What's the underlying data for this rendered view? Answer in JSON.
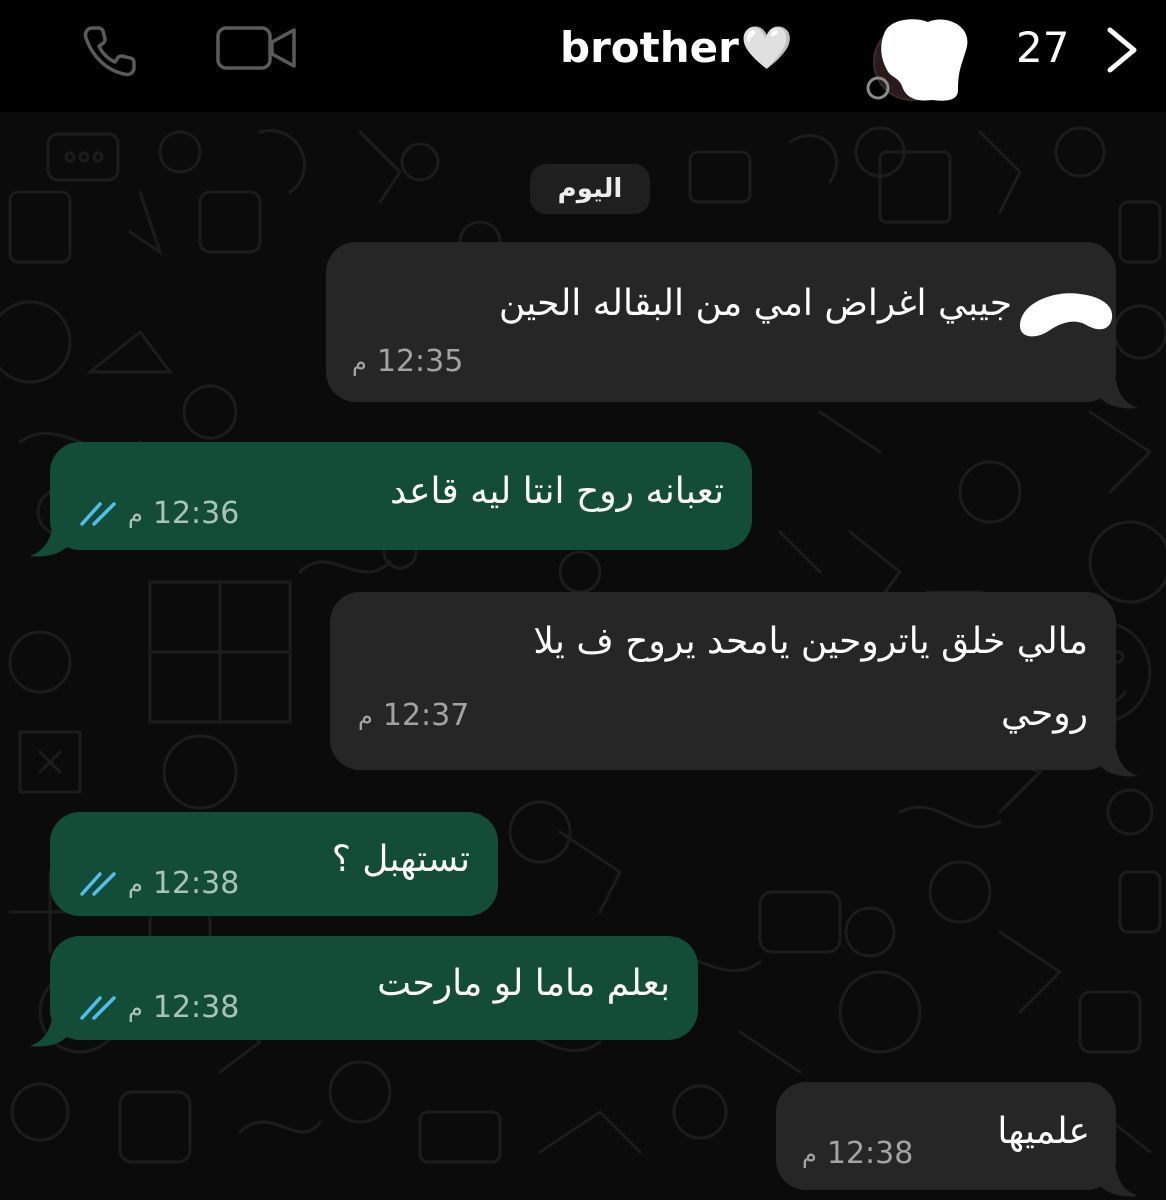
{
  "header": {
    "contact_name": "brother",
    "name_emoji": "🤍",
    "back_count": "27",
    "icons": {
      "call": "phone-icon",
      "video": "video-call-icon",
      "back": "chevron-right-icon",
      "avatar": "avatar-icon"
    }
  },
  "chat": {
    "day_label": "اليوم",
    "messages": [
      {
        "direction": "incoming",
        "text": "جيبي اغراض امي من البقاله الحين",
        "time": "12:35",
        "ampm": "م",
        "read": false
      },
      {
        "direction": "outgoing",
        "text": "تعبانه روح انتا ليه قاعد",
        "time": "12:36",
        "ampm": "م",
        "read": true
      },
      {
        "direction": "incoming",
        "text_line1": "مالي خلق ياتروحين يامحد يروح ف يلا",
        "text_line2": "روحي",
        "time": "12:37",
        "ampm": "م",
        "read": false
      },
      {
        "direction": "outgoing",
        "text": "تستهبل ؟",
        "time": "12:38",
        "ampm": "م",
        "read": true
      },
      {
        "direction": "outgoing",
        "text": "بعلم ماما لو مارحت",
        "time": "12:38",
        "ampm": "م",
        "read": true
      },
      {
        "direction": "incoming",
        "text": "علميها",
        "time": "12:38",
        "ampm": "م",
        "read": false
      }
    ]
  },
  "colors": {
    "background": "#0b0b0b",
    "header": "#000000",
    "incoming_bubble": "#262626",
    "outgoing_bubble": "#144d37",
    "read_ticks": "#53bdeb"
  }
}
